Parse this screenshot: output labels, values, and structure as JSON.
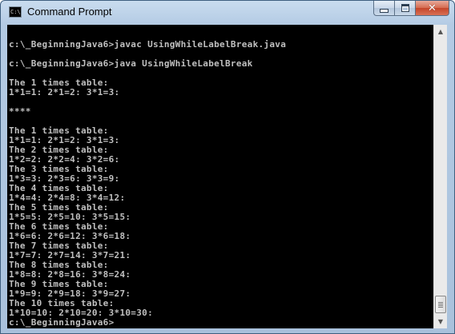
{
  "window": {
    "title": "Command Prompt",
    "icon": "cmd-icon",
    "icon_text": "C:\\",
    "controls": {
      "minimize_icon": "minimize-icon",
      "maximize_icon": "maximize-icon",
      "close_icon": "close-icon",
      "close_glyph": "✕"
    }
  },
  "colors": {
    "console_background": "#000000",
    "console_text": "#c0c0c0",
    "close_button": "#c4452a"
  },
  "console": {
    "lines": [
      "",
      "c:\\_BeginningJava6>javac UsingWhileLabelBreak.java",
      "",
      "c:\\_BeginningJava6>java UsingWhileLabelBreak",
      "",
      "The 1 times table:",
      "1*1=1: 2*1=2: 3*1=3:",
      "",
      "****",
      "",
      "The 1 times table:",
      "1*1=1: 2*1=2: 3*1=3:",
      "The 2 times table:",
      "1*2=2: 2*2=4: 3*2=6:",
      "The 3 times table:",
      "1*3=3: 2*3=6: 3*3=9:",
      "The 4 times table:",
      "1*4=4: 2*4=8: 3*4=12:",
      "The 5 times table:",
      "1*5=5: 2*5=10: 3*5=15:",
      "The 6 times table:",
      "1*6=6: 2*6=12: 3*6=18:",
      "The 7 times table:",
      "1*7=7: 2*7=14: 3*7=21:",
      "The 8 times table:",
      "1*8=8: 2*8=16: 3*8=24:",
      "The 9 times table:",
      "1*9=9: 2*9=18: 3*9=27:",
      "The 10 times table:",
      "1*10=10: 2*10=20: 3*10=30:",
      "c:\\_BeginningJava6>"
    ]
  },
  "scrollbar": {
    "up_arrow": "▲",
    "down_arrow": "▼",
    "up_icon": "scroll-up-arrow-icon",
    "down_icon": "scroll-down-arrow-icon",
    "position": 1.0
  }
}
